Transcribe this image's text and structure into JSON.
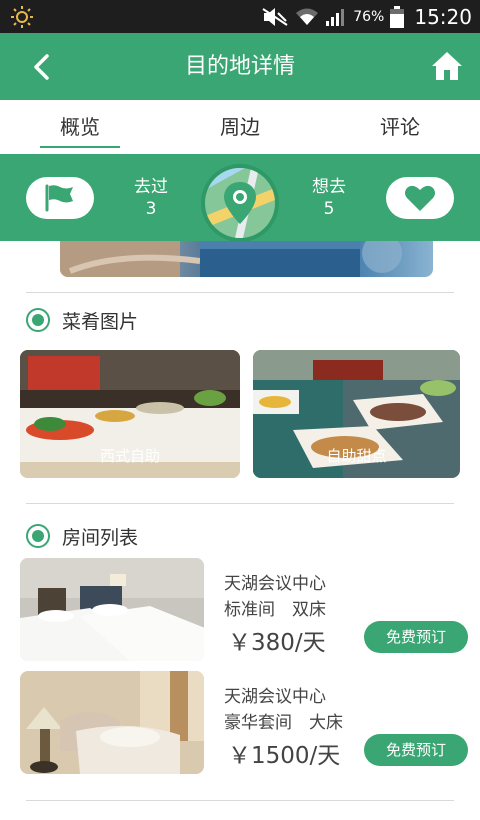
{
  "status_bar": {
    "battery_percent": "76%",
    "time": "15:20"
  },
  "header": {
    "title": "目的地详情"
  },
  "tabs": [
    {
      "label": "概览",
      "active": true
    },
    {
      "label": "周边",
      "active": false
    },
    {
      "label": "评论",
      "active": false
    }
  ],
  "stats": {
    "visited": {
      "label": "去过",
      "count": "3"
    },
    "want": {
      "label": "想去",
      "count": "5"
    }
  },
  "dishes": {
    "title": "菜肴图片",
    "items": [
      {
        "label": "西式自助"
      },
      {
        "label": "自助甜点"
      }
    ]
  },
  "rooms": {
    "title": "房间列表",
    "items": [
      {
        "hotel": "天湖会议中心",
        "type": "标准间　双床",
        "price": "￥380/天",
        "button": "免费预订"
      },
      {
        "hotel": "天湖会议中心",
        "type": "豪华套间　大床",
        "price": "￥1500/天",
        "button": "免费预订"
      }
    ]
  },
  "colors": {
    "accent": "#3aa673",
    "status_bar": "#1e1e1e"
  }
}
